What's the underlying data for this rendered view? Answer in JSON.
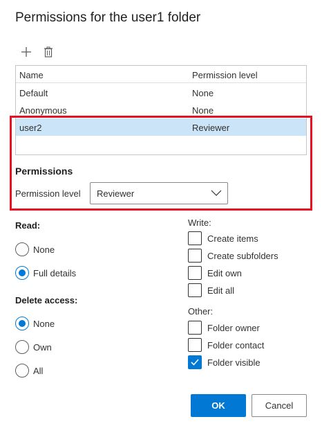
{
  "dialog": {
    "title": "Permissions for the user1 folder"
  },
  "toolbar": {
    "add_icon": "add-icon",
    "delete_icon": "trash-icon"
  },
  "list": {
    "headers": [
      "Name",
      "Permission level"
    ],
    "rows": [
      {
        "name": "Default",
        "level": "None",
        "selected": false
      },
      {
        "name": "Anonymous",
        "level": "None",
        "selected": false
      },
      {
        "name": "user2",
        "level": "Reviewer",
        "selected": true
      }
    ]
  },
  "permissions": {
    "heading": "Permissions",
    "level_label": "Permission level",
    "level_value": "Reviewer"
  },
  "read": {
    "label": "Read:",
    "options": [
      {
        "label": "None",
        "checked": false
      },
      {
        "label": "Full details",
        "checked": true
      }
    ]
  },
  "delete_access": {
    "label": "Delete access:",
    "options": [
      {
        "label": "None",
        "checked": true
      },
      {
        "label": "Own",
        "checked": false
      },
      {
        "label": "All",
        "checked": false
      }
    ]
  },
  "write": {
    "label": "Write:",
    "options": [
      {
        "label": "Create items",
        "checked": false
      },
      {
        "label": "Create subfolders",
        "checked": false
      },
      {
        "label": "Edit own",
        "checked": false
      },
      {
        "label": "Edit all",
        "checked": false
      }
    ]
  },
  "other": {
    "label": "Other:",
    "options": [
      {
        "label": "Folder owner",
        "checked": false
      },
      {
        "label": "Folder contact",
        "checked": false
      },
      {
        "label": "Folder visible",
        "checked": true
      }
    ]
  },
  "buttons": {
    "ok": "OK",
    "cancel": "Cancel"
  },
  "colors": {
    "accent": "#0078d4",
    "highlight": "#e81123",
    "selected_row": "#cce4f7"
  }
}
